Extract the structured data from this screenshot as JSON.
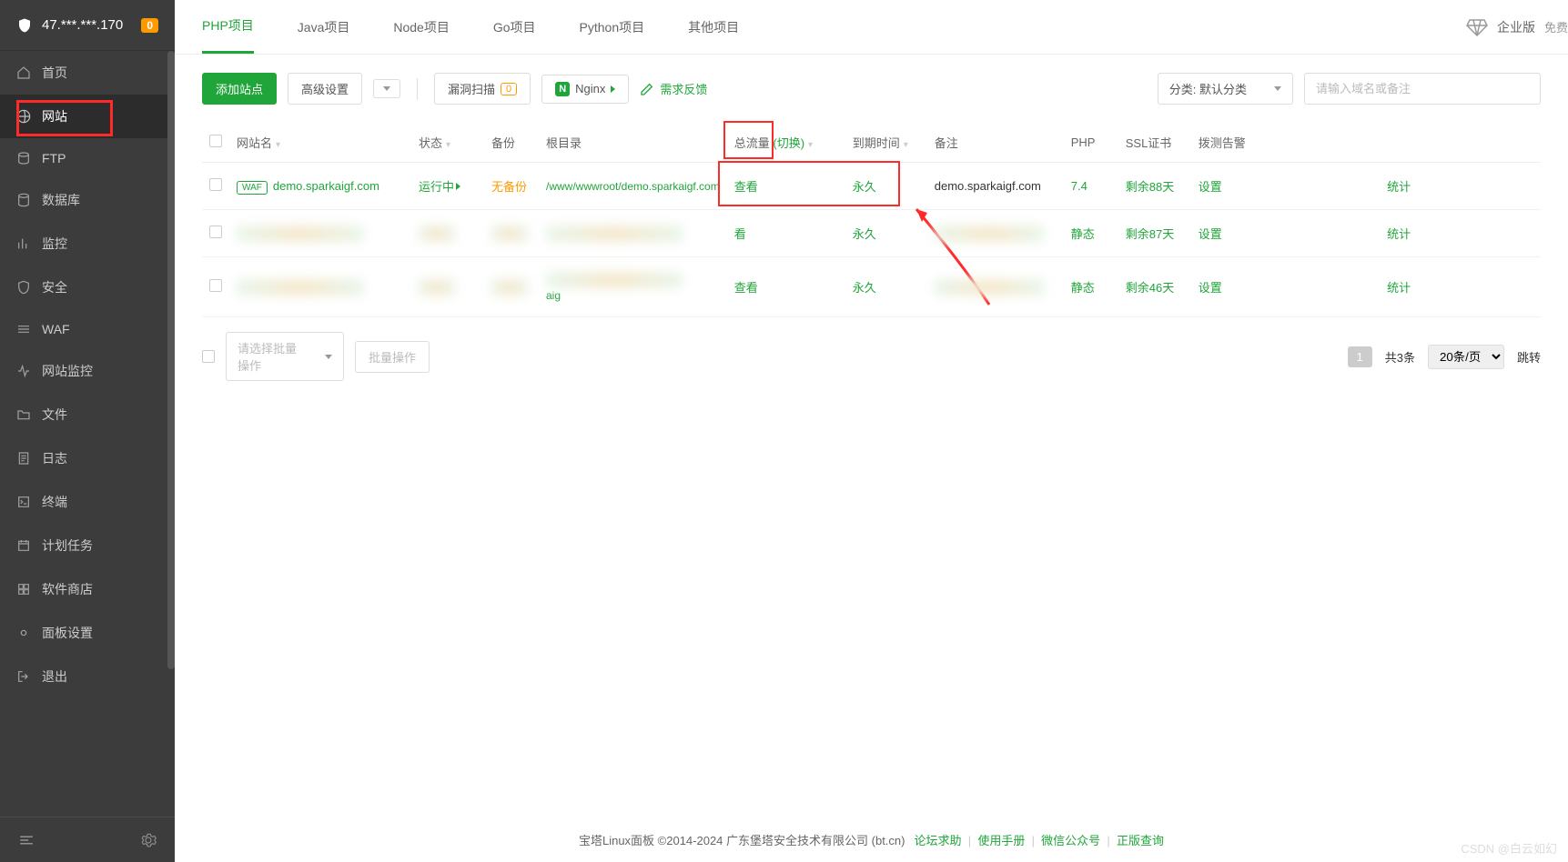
{
  "header": {
    "ip": "47.***.***.170",
    "alert_count": "0"
  },
  "sidebar": {
    "items": [
      {
        "label": "首页",
        "icon": "home"
      },
      {
        "label": "网站",
        "icon": "globe",
        "active": true
      },
      {
        "label": "FTP",
        "icon": "disk"
      },
      {
        "label": "数据库",
        "icon": "db"
      },
      {
        "label": "监控",
        "icon": "chart"
      },
      {
        "label": "安全",
        "icon": "shield"
      },
      {
        "label": "WAF",
        "icon": "waf"
      },
      {
        "label": "网站监控",
        "icon": "pulse"
      },
      {
        "label": "文件",
        "icon": "folder"
      },
      {
        "label": "日志",
        "icon": "log"
      },
      {
        "label": "终端",
        "icon": "terminal"
      },
      {
        "label": "计划任务",
        "icon": "calendar"
      },
      {
        "label": "软件商店",
        "icon": "apps"
      },
      {
        "label": "面板设置",
        "icon": "gear"
      },
      {
        "label": "退出",
        "icon": "exit"
      }
    ]
  },
  "tabs": {
    "items": [
      "PHP项目",
      "Java项目",
      "Node项目",
      "Go项目",
      "Python项目",
      "其他项目"
    ],
    "active": 0,
    "version_label": "企业版",
    "version_free": "免费"
  },
  "toolbar": {
    "add_site": "添加站点",
    "advanced": "高级设置",
    "vuln_scan": "漏洞扫描",
    "vuln_badge": "0",
    "nginx": "Nginx",
    "feedback": "需求反馈",
    "category_label": "分类: 默认分类",
    "search_placeholder": "请输入域名或备注"
  },
  "columns": {
    "site": "网站名",
    "status": "状态",
    "backup": "备份",
    "root": "根目录",
    "traffic": "总流量",
    "traffic_switch": "(切换)",
    "expire": "到期时间",
    "remark": "备注",
    "php": "PHP",
    "ssl": "SSL证书",
    "alert": "拨测告警"
  },
  "rows": [
    {
      "site": "demo.sparkaigf.com",
      "status": "运行中",
      "backup": "无备份",
      "root": "/www/wwwroot/demo.sparkaigf.com",
      "traffic": "查看",
      "expire": "永久",
      "remark": "demo.sparkaigf.com",
      "php": "7.4",
      "ssl": "剩余88天",
      "setting": "设置",
      "stat": "统计",
      "blurred": false
    },
    {
      "traffic": "看",
      "expire": "永久",
      "php": "静态",
      "ssl": "剩余87天",
      "setting": "设置",
      "stat": "统计",
      "blurred": true
    },
    {
      "root_suffix": "aig",
      "traffic": "查看",
      "expire": "永久",
      "php": "静态",
      "ssl": "剩余46天",
      "setting": "设置",
      "stat": "统计",
      "blurred": true
    }
  ],
  "batch": {
    "select_placeholder": "请选择批量操作",
    "exec": "批量操作"
  },
  "pagination": {
    "page": "1",
    "total": "共3条",
    "per": "20条/页",
    "jump": "跳转"
  },
  "footer": {
    "text": "宝塔Linux面板 ©2014-2024 广东堡塔安全技术有限公司 (bt.cn)",
    "links": [
      "论坛求助",
      "使用手册",
      "微信公众号",
      "正版查询"
    ]
  },
  "watermark": "CSDN @白云如幻"
}
